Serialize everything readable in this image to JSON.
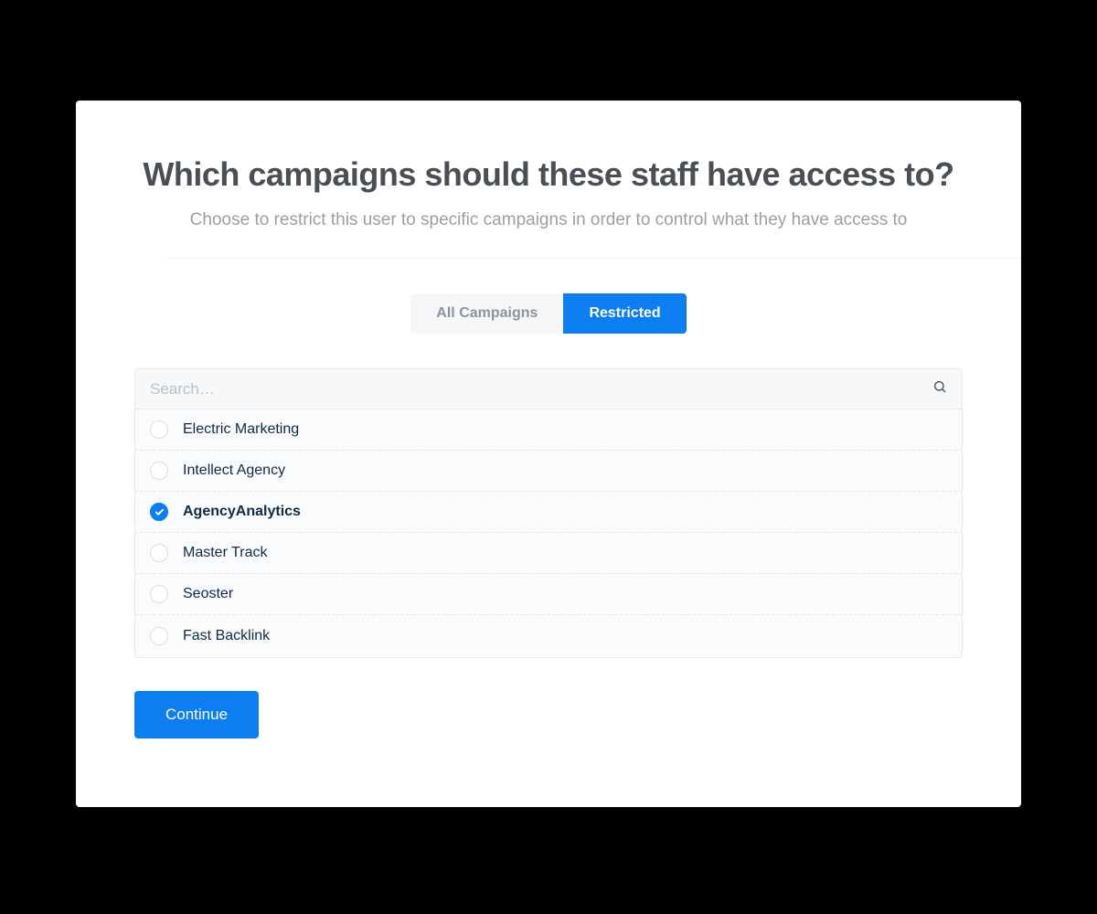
{
  "header": {
    "title": "Which campaigns should these staff have access to?",
    "subtitle": "Choose to restrict this user to specific campaigns in order to control what they have access to"
  },
  "toggle": {
    "all_label": "All Campaigns",
    "restricted_label": "Restricted"
  },
  "search": {
    "placeholder": "Search…"
  },
  "campaigns": [
    {
      "label": "Electric Marketing",
      "selected": false
    },
    {
      "label": "Intellect Agency",
      "selected": false
    },
    {
      "label": "AgencyAnalytics",
      "selected": true
    },
    {
      "label": "Master Track",
      "selected": false
    },
    {
      "label": "Seoster",
      "selected": false
    },
    {
      "label": "Fast Backlink",
      "selected": false
    }
  ],
  "actions": {
    "continue_label": "Continue"
  },
  "colors": {
    "primary": "#0d7ef2",
    "text_dark": "#4a4f55",
    "text_muted": "#97a0a8",
    "row_text": "#122a44"
  }
}
